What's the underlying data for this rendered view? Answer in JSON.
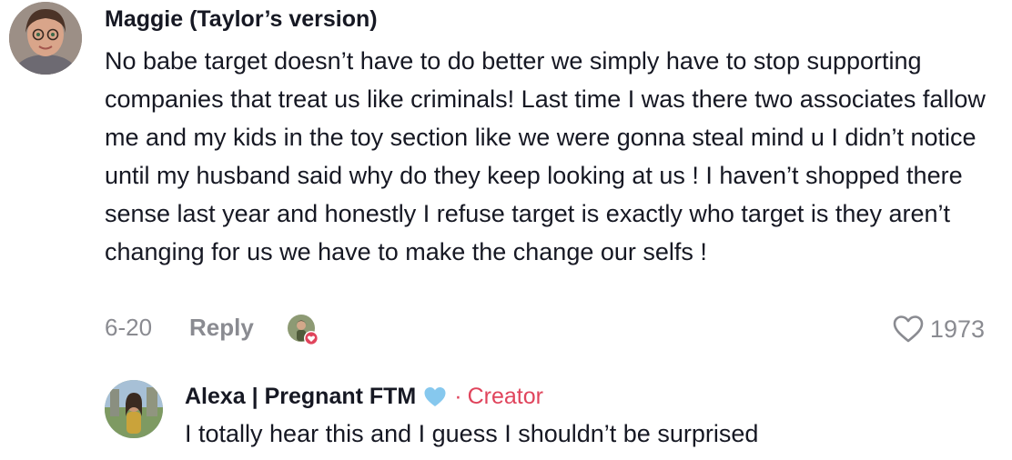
{
  "comment": {
    "author": "Maggie (Taylor’s version)",
    "text": "No babe target doesn’t have to do better we simply have to stop supporting companies that treat us like criminals! Last time I was there two associates fallow me and my kids in the toy section like we were gonna steal mind u I didn’t notice until my husband said why do they keep looking at us ! I haven’t shopped there sense last year and honestly I refuse target is exactly who target is they aren’t changing for us we have to make the change our selfs !",
    "date": "6-20",
    "reply_label": "Reply",
    "likes": "1973",
    "icons": {
      "like": "heart-outline-icon",
      "creator_liked": "creator-liked-avatar-badge"
    }
  },
  "reply": {
    "author": "Alexa | Pregnant FTM",
    "emoji": "light-blue-heart-icon",
    "separator": "·",
    "tag": "Creator",
    "text": "I totally hear this and I guess I shouldn’t be surprised"
  },
  "colors": {
    "text": "#161823",
    "muted": "#8a8b91",
    "creator": "#e0445c",
    "heart_emoji": "#86c8ee"
  }
}
